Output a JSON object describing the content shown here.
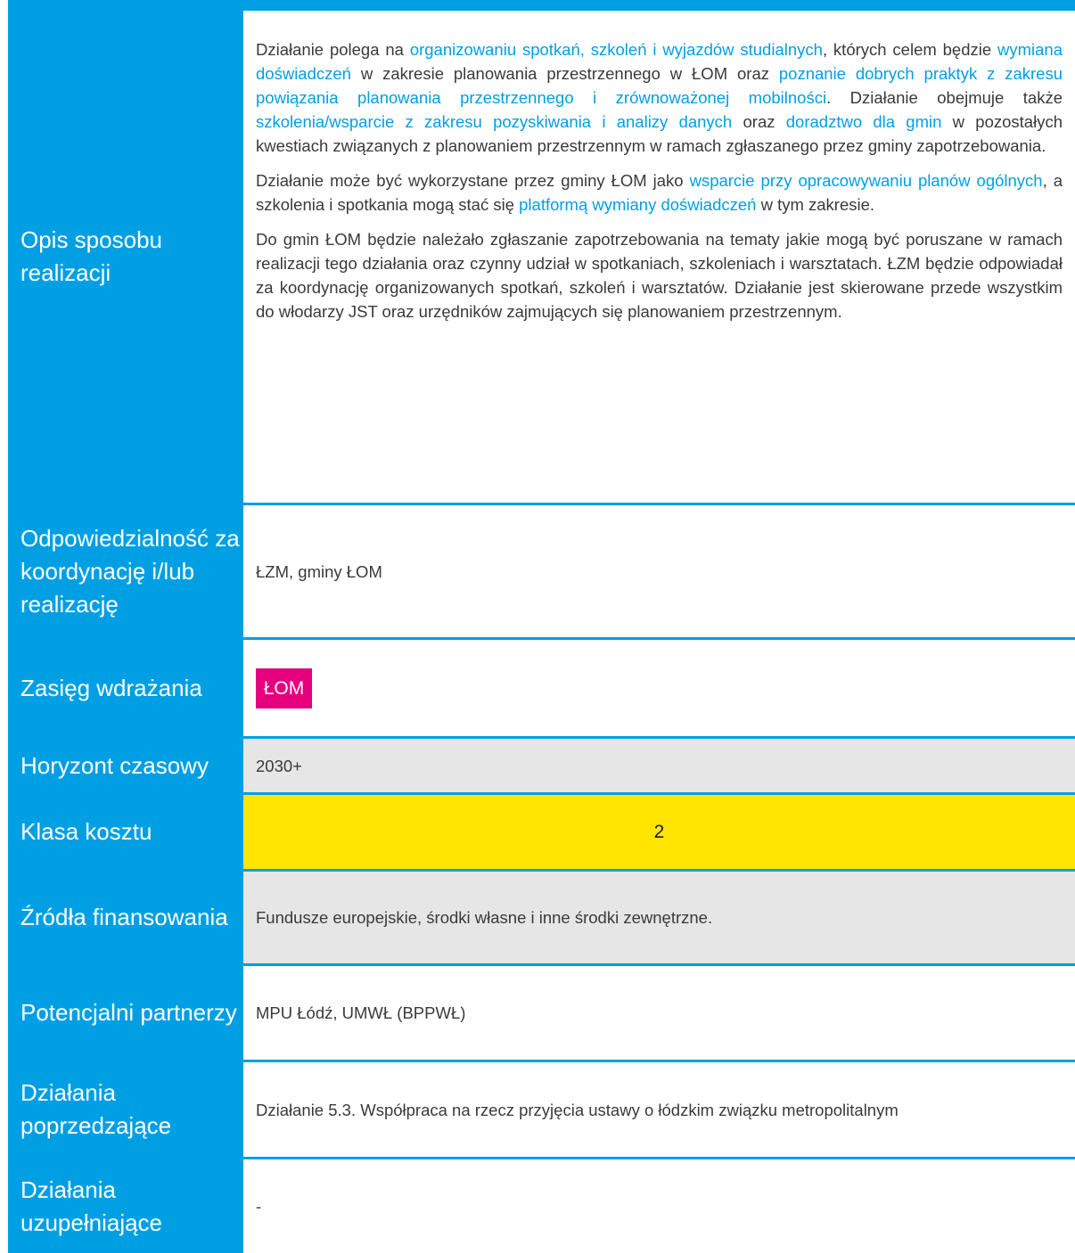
{
  "rows": {
    "opis": {
      "label": "Opis sposobu realizacji",
      "p1": [
        "Działanie polega na ",
        "organizowaniu spotkań, szkoleń i wyjazdów studialnych",
        ", których celem będzie ",
        "wymiana doświadczeń",
        " w zakresie planowania przestrzennego w ŁOM oraz ",
        "poznanie dobrych praktyk z zakresu powiązania planowania przestrzennego i zrównoważonej mobilności",
        ". Działanie obejmuje także ",
        "szkolenia/wsparcie z zakresu pozyskiwania i analizy danych",
        " oraz ",
        "doradztwo dla gmin",
        " w pozostałych kwestiach związanych z planowaniem przestrzennym w ramach zgłaszanego przez gminy zapotrzebowania."
      ],
      "p2": [
        "Działanie może być wykorzystane przez gminy ŁOM jako ",
        "wsparcie przy opracowywaniu planów ogólnych",
        ", a szkolenia i spotkania mogą stać się ",
        "platformą wymiany doświadczeń",
        " w tym zakresie."
      ],
      "p3": "Do gmin ŁOM będzie należało zgłaszanie zapotrzebowania na tematy jakie mogą być poruszane w ramach realizacji tego działania oraz czynny udział w spotkaniach, szkoleniach i warsztatach. ŁZM będzie odpowiadał za koordynację organizowanych spotkań, szkoleń i warsztatów. Działanie jest skierowane przede wszystkim do włodarzy JST oraz urzędników zajmujących się planowaniem przestrzennym."
    },
    "odpowiedzialnosc": {
      "label": "Odpowiedzialność za koordynację i/lub realizację",
      "value": "ŁZM, gminy ŁOM"
    },
    "zasieg": {
      "label": "Zasięg wdrażania",
      "badge": "ŁOM",
      "badge_color": "#e6007e"
    },
    "horyzont": {
      "label": "Horyzont czasowy",
      "value": "2030+"
    },
    "klasa": {
      "label": "Klasa kosztu",
      "value": "2",
      "color": "#ffe500"
    },
    "zrodla": {
      "label": "Źródła finansowania",
      "value": "Fundusze europejskie, środki własne i inne środki zewnętrzne."
    },
    "partnerzy": {
      "label": "Potencjalni partnerzy",
      "value": "MPU Łódź, UMWŁ (BPPWŁ)"
    },
    "poprzedzajace": {
      "label": "Działania poprzedzające",
      "value": "Działanie 5.3. Współpraca na rzecz przyjęcia ustawy o łódzkim związku metropolitalnym"
    },
    "uzupelniajace": {
      "label": "Działania uzupełniające",
      "value": "-"
    }
  },
  "colors": {
    "accent": "#009fe3",
    "grey": "#e6e6e6"
  }
}
